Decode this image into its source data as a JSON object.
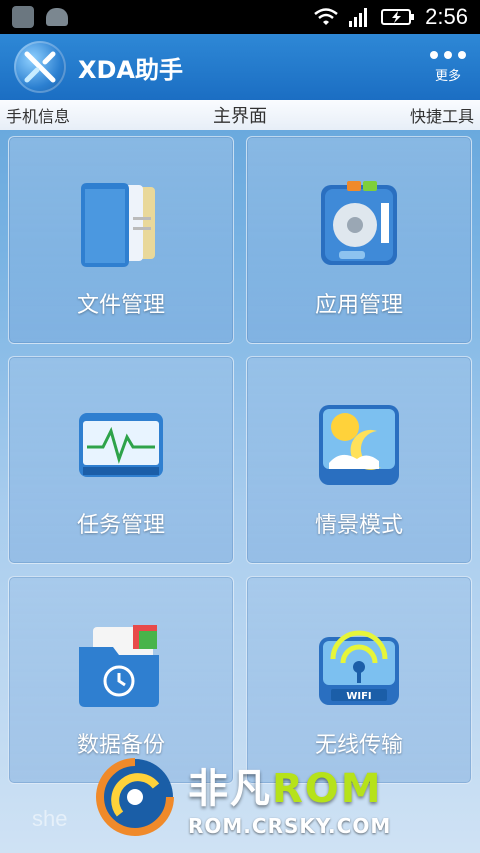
{
  "status_bar": {
    "time": "2:56"
  },
  "header": {
    "title": "XDA助手",
    "more_label": "更多"
  },
  "tabs": {
    "left": "手机信息",
    "center": "主界面",
    "right": "快捷工具"
  },
  "tiles": [
    {
      "label": "文件管理",
      "icon": "folder-document-icon"
    },
    {
      "label": "应用管理",
      "icon": "app-box-icon"
    },
    {
      "label": "任务管理",
      "icon": "task-monitor-icon"
    },
    {
      "label": "情景模式",
      "icon": "weather-moon-icon"
    },
    {
      "label": "数据备份",
      "icon": "backup-folder-icon"
    },
    {
      "label": "无线传输",
      "icon": "wifi-tower-icon"
    }
  ],
  "watermark": {
    "brand": "非凡ROM",
    "url": "ROM.CRSKY.COM",
    "bg_text": "she"
  },
  "colors": {
    "header": "#1b6ec3",
    "tile": "#8fb9e6",
    "rom_green": "#b6e21a"
  }
}
